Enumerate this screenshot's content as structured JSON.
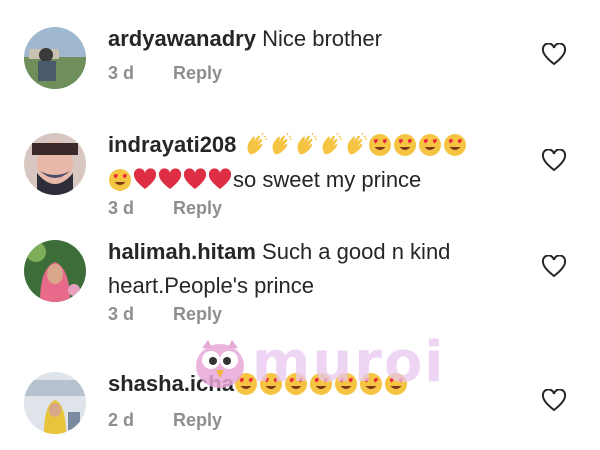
{
  "comments": [
    {
      "username": "ardyawanadry",
      "text": "Nice brother",
      "time": "3 d",
      "reply_label": "Reply",
      "avatar_icon": "avatar-man-outdoors",
      "emojis": []
    },
    {
      "username": "indrayati208",
      "text_line1_emojis": [
        "clap",
        "clap",
        "clap",
        "clap",
        "clap",
        "heart-eyes",
        "heart-eyes",
        "heart-eyes",
        "heart-eyes"
      ],
      "text_line2_emojis": [
        "heart-eyes",
        "red-heart",
        "red-heart",
        "red-heart",
        "red-heart"
      ],
      "text": "so sweet my prince",
      "time": "3 d",
      "reply_label": "Reply",
      "avatar_icon": "avatar-woman-mask"
    },
    {
      "username": "halimah.hitam",
      "text_line1": "Such a good n kind",
      "text_line2": "heart.People's prince",
      "time": "3 d",
      "reply_label": "Reply",
      "avatar_icon": "avatar-woman-hijab"
    },
    {
      "username": "shasha.icha",
      "emojis": [
        "heart-eyes",
        "heart-eyes",
        "heart-eyes",
        "heart-eyes",
        "heart-eyes",
        "heart-eyes",
        "heart-eyes"
      ],
      "time": "2 d",
      "reply_label": "Reply",
      "avatar_icon": "avatar-person-photo"
    }
  ],
  "watermark": {
    "text": "muroi",
    "icon": "owl-mascot-icon"
  },
  "colors": {
    "meta": "#8e8e8e",
    "text": "#262626",
    "watermark": "#e8c8ef"
  }
}
